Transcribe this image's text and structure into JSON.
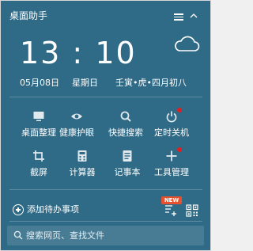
{
  "app": {
    "title": "桌面助手"
  },
  "clock": {
    "time": "13 : 10",
    "date": "05月08日",
    "weekday": "星期日",
    "lunar": "壬寅•虎•四月初八"
  },
  "tools": [
    {
      "label": "桌面整理",
      "icon": "monitor-icon",
      "notify": false
    },
    {
      "label": "健康护眼",
      "icon": "eye-icon",
      "notify": false
    },
    {
      "label": "快捷搜索",
      "icon": "search-icon",
      "notify": false
    },
    {
      "label": "定时关机",
      "icon": "power-icon",
      "notify": true
    },
    {
      "label": "截屏",
      "icon": "crop-icon",
      "notify": false
    },
    {
      "label": "计算器",
      "icon": "calculator-icon",
      "notify": false
    },
    {
      "label": "记事本",
      "icon": "notepad-icon",
      "notify": false
    },
    {
      "label": "工具管理",
      "icon": "plus-icon",
      "notify": true
    }
  ],
  "todo": {
    "label": "添加待办事项",
    "new_badge": "NEW"
  },
  "search": {
    "placeholder": "搜索网页、查找文件"
  },
  "colors": {
    "background": "#2f6a86",
    "text": "#ffffff",
    "badge": "#e8502e",
    "notify_dot": "#e02020"
  }
}
